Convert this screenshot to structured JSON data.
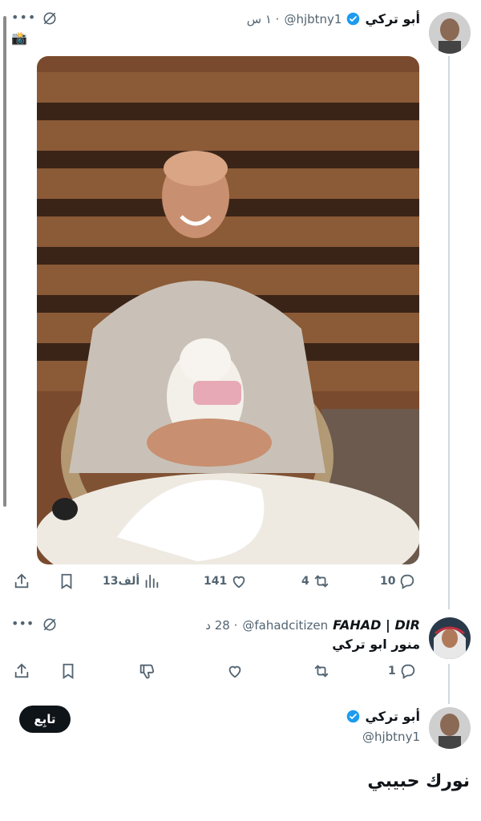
{
  "tweet1": {
    "display_name": "أبو تركي",
    "handle": "@hjbtny1",
    "time": "· ١ س",
    "media_alt": "",
    "actions": {
      "replies": "10",
      "retweets": "4",
      "likes": "141",
      "views": "13ألف"
    }
  },
  "reply": {
    "display_name": "FAHAD | DIR",
    "handle": "@fahadcitizen",
    "time": "· 28 د",
    "text": "منور ابو تركي",
    "actions": {
      "replies": "1"
    }
  },
  "tweet2": {
    "display_name": "أبو تركي",
    "handle": "@hjbtny1",
    "follow_label": "تابِع",
    "text": "نورك حبيبي"
  },
  "colors": {
    "verified": "#1d9bf0",
    "muted": "#536471",
    "thread_line": "#cfd9de"
  }
}
